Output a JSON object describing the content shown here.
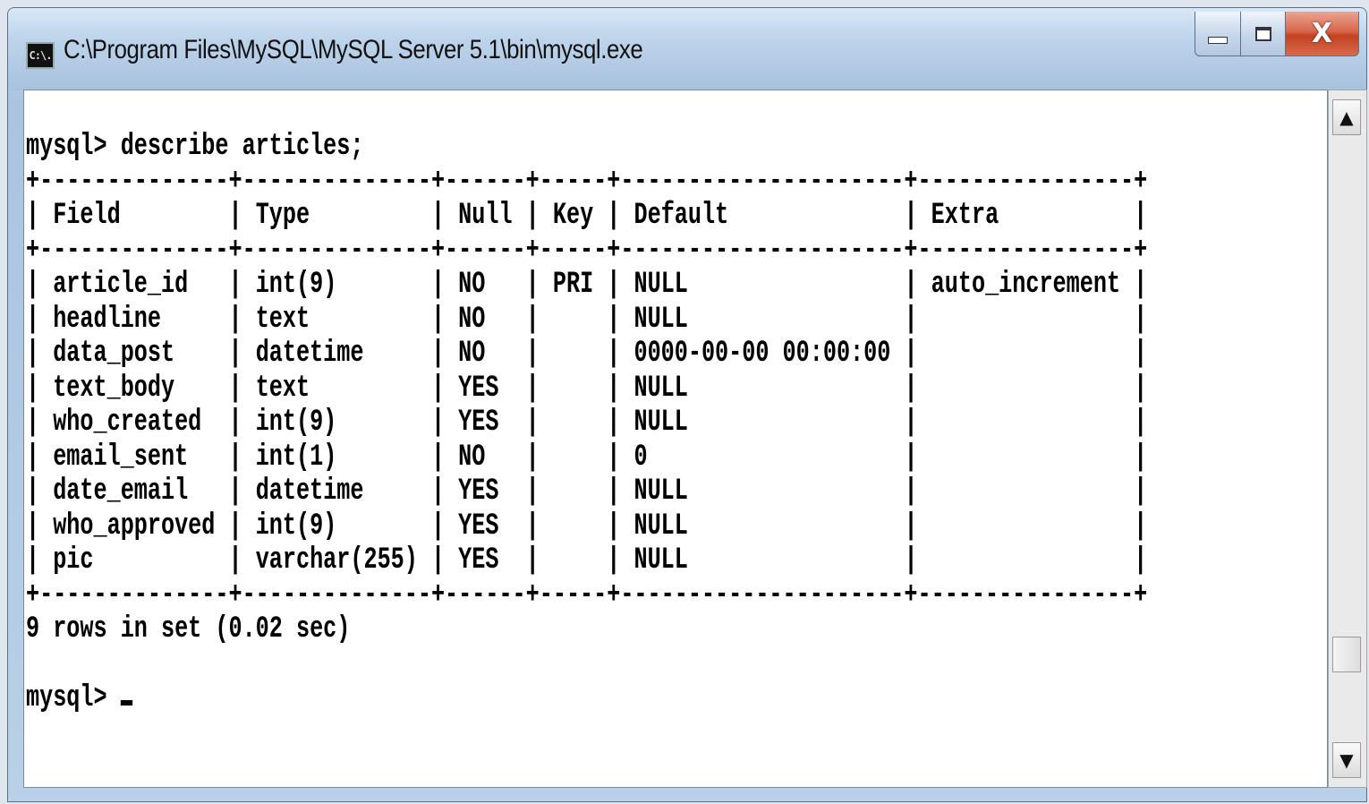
{
  "window": {
    "title": "C:\\Program Files\\MySQL\\MySQL Server 5.1\\bin\\mysql.exe",
    "icon_label": "C:\\."
  },
  "controls": {
    "close_label": "X"
  },
  "console": {
    "command": "mysql> describe articles;",
    "table": {
      "columns": [
        "Field",
        "Type",
        "Null",
        "Key",
        "Default",
        "Extra"
      ],
      "rows": [
        [
          "article_id",
          "int(9)",
          "NO",
          "PRI",
          "NULL",
          "auto_increment"
        ],
        [
          "headline",
          "text",
          "NO",
          "",
          "NULL",
          ""
        ],
        [
          "data_post",
          "datetime",
          "NO",
          "",
          "0000-00-00 00:00:00",
          ""
        ],
        [
          "text_body",
          "text",
          "YES",
          "",
          "NULL",
          ""
        ],
        [
          "who_created",
          "int(9)",
          "YES",
          "",
          "NULL",
          ""
        ],
        [
          "email_sent",
          "int(1)",
          "NO",
          "",
          "0",
          ""
        ],
        [
          "date_email",
          "datetime",
          "YES",
          "",
          "NULL",
          ""
        ],
        [
          "who_approved",
          "int(9)",
          "YES",
          "",
          "NULL",
          ""
        ],
        [
          "pic",
          "varchar(255)",
          "YES",
          "",
          "NULL",
          ""
        ]
      ]
    },
    "result_summary": "9 rows in set (0.02 sec)",
    "prompt": "mysql> "
  },
  "scrollbar": {
    "up_arrow": "▲",
    "down_arrow": "▼"
  }
}
